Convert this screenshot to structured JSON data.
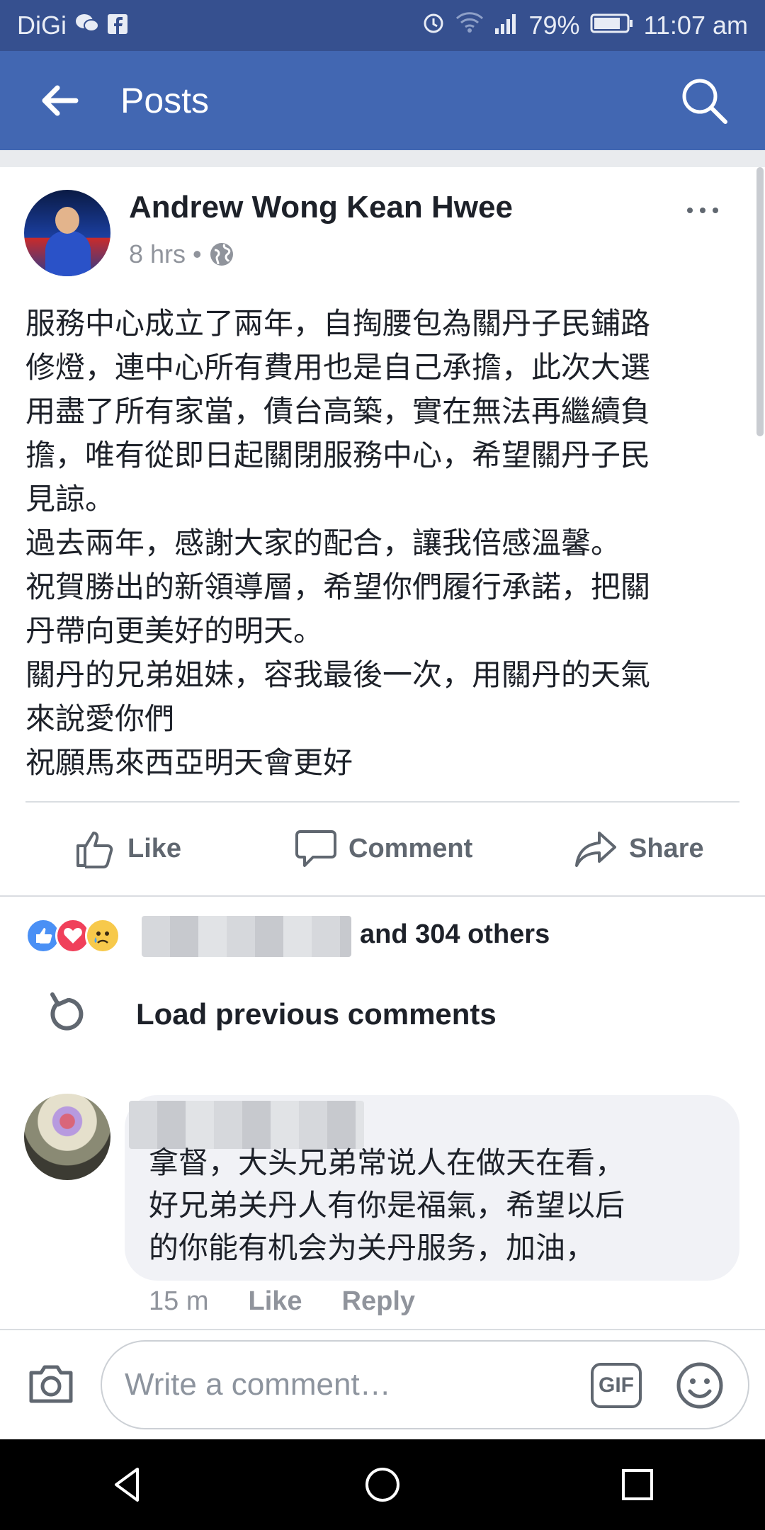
{
  "status_bar": {
    "carrier": "DiGi",
    "battery_percent": "79%",
    "time": "11:07 am"
  },
  "app_bar": {
    "title": "Posts"
  },
  "post": {
    "author": "Andrew Wong Kean Hwee",
    "time_ago": "8 hrs",
    "separator": "•",
    "paragraphs": [
      "服務中心成立了兩年，自掏腰包為關丹子民鋪路",
      "修燈，連中心所有費用也是自己承擔，此次大選",
      "用盡了所有家當，債台高築，實在無法再繼續負",
      "擔，唯有從即日起關閉服務中心，希望關丹子民",
      "見諒。",
      "過去兩年，感謝大家的配合，讓我倍感溫馨。",
      "祝賀勝出的新領導層，希望你們履行承諾，把關",
      "丹帶向更美好的明天。",
      "關丹的兄弟姐妹，容我最後一次，用關丹的天氣",
      "來說愛你們",
      "祝願馬來西亞明天會更好"
    ],
    "actions": {
      "like": "Like",
      "comment": "Comment",
      "share": "Share"
    }
  },
  "reactions": {
    "summary": "and 304 others"
  },
  "comments": {
    "load_previous": "Load previous comments",
    "items": [
      {
        "lines": [
          "拿督，大头兄弟常说人在做天在看，",
          "好兄弟关丹人有你是福氣，希望以后",
          "的你能有机会为关丹服务，加油，"
        ],
        "time_ago": "15 m",
        "like": "Like",
        "reply": "Reply"
      }
    ]
  },
  "composer": {
    "placeholder": "Write a comment…",
    "gif_label": "GIF"
  },
  "colors": {
    "brand_blue": "#4267b2",
    "status_blue": "#36508f"
  }
}
